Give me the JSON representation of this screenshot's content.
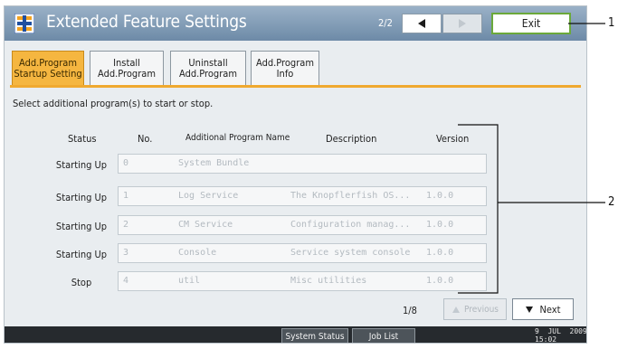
{
  "header": {
    "title": "Extended Feature Settings",
    "page_indicator": "2/2",
    "exit_label": "Exit"
  },
  "tabs": [
    {
      "line1": "Add.Program",
      "line2": "Startup Setting",
      "active": true
    },
    {
      "line1": "Install",
      "line2": "Add.Program",
      "active": false
    },
    {
      "line1": "Uninstall",
      "line2": "Add.Program",
      "active": false
    },
    {
      "line1": "Add.Program",
      "line2": "Info",
      "active": false
    }
  ],
  "instruction": "Select additional program(s) to start or stop.",
  "table": {
    "headers": {
      "status": "Status",
      "no": "No.",
      "name": "Additional Program Name",
      "description": "Description",
      "version": "Version"
    },
    "rows": [
      {
        "status": "Starting Up",
        "no": "0",
        "name": "System Bundle",
        "description": "",
        "version": ""
      },
      {
        "status": "Starting Up",
        "no": "1",
        "name": "Log Service",
        "description": "The Knopflerfish OS...",
        "version": "1.0.0"
      },
      {
        "status": "Starting Up",
        "no": "2",
        "name": "CM Service",
        "description": "Configuration manag...",
        "version": "1.0.0"
      },
      {
        "status": "Starting Up",
        "no": "3",
        "name": "Console",
        "description": "Service system console",
        "version": "1.0.0"
      },
      {
        "status": "Stop",
        "no": "4",
        "name": "util",
        "description": "Misc utilities",
        "version": "1.0.0"
      }
    ],
    "page": "1/8",
    "previous_label": "Previous",
    "next_label": "Next"
  },
  "bottom_bar": {
    "system_status_label": "System Status",
    "job_list_label": "Job List",
    "date": "9  JUL  2009",
    "time": "15:02"
  },
  "callouts": [
    "1",
    "2"
  ],
  "colors": {
    "header": "#7d98b3",
    "active_tab": "#f5b640",
    "exit_border": "#6ba93a",
    "bottom_bar": "#262a2e"
  }
}
